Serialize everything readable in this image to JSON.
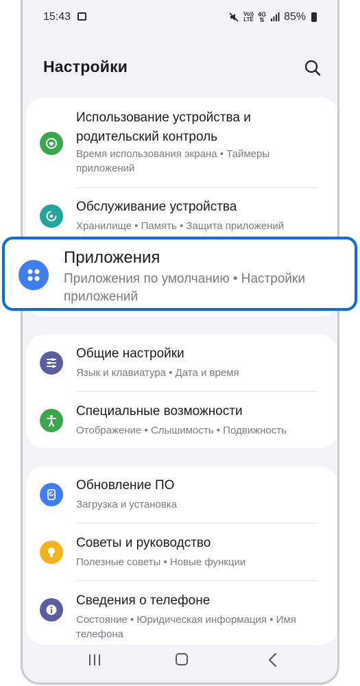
{
  "status_bar": {
    "time": "15:43",
    "network": "4G",
    "volte_top": "Vo))",
    "volte_bottom": "LTE",
    "battery": "85%"
  },
  "header": {
    "title": "Настройки",
    "search_icon": "search-icon"
  },
  "items": [
    {
      "title": "Использование устройства и родительский контроль",
      "subtitle": "Время использования экрана • Таймеры приложений",
      "icon": "digital-wellbeing-icon",
      "color": "#3aa84a"
    },
    {
      "title": "Обслуживание устройства",
      "subtitle": "Хранилище • Память • Защита приложений",
      "icon": "device-care-icon",
      "color": "#1fa59a"
    },
    {
      "title": "Общие настройки",
      "subtitle": "Язык и клавиатура • Дата и время",
      "icon": "sliders-icon",
      "color": "#5b5e9e"
    },
    {
      "title": "Специальные возможности",
      "subtitle": "Отображение • Слышимость • Подвижность",
      "icon": "accessibility-icon",
      "color": "#3aa84a"
    },
    {
      "title": "Обновление ПО",
      "subtitle": "Загрузка и установка",
      "icon": "software-update-icon",
      "color": "#3d7ef5"
    },
    {
      "title": "Советы и руководство",
      "subtitle": "Полезные советы • Новые функции",
      "icon": "lightbulb-icon",
      "color": "#f2b418"
    },
    {
      "title": "Сведения о телефоне",
      "subtitle": "Состояние • Юридическая информация • Имя телефона",
      "icon": "info-icon",
      "color": "#5b5e9e"
    }
  ],
  "highlighted": {
    "title": "Приложения",
    "subtitle": "Приложения по умолчанию • Настройки приложений",
    "icon": "apps-icon",
    "color": "#3d7ef5",
    "border_color": "#0a6fd8"
  },
  "nav": {
    "recent_icon": "recent-apps-icon",
    "home_icon": "home-icon",
    "back_icon": "back-icon"
  }
}
